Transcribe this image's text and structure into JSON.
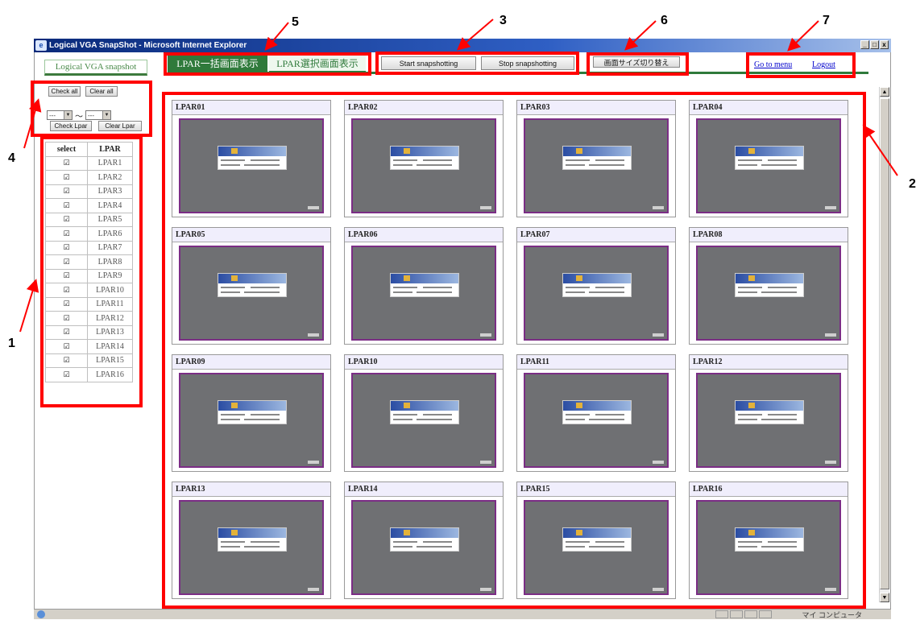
{
  "window": {
    "title": "Logical VGA SnapShot - Microsoft Internet Explorer",
    "controls": [
      "_",
      "□",
      "x"
    ],
    "status_zone": "マイ コンピュータ"
  },
  "app_title": "Logical VGA snapshot",
  "controls": {
    "check_all": "Check all",
    "clear_all": "Clear all",
    "range_from": "---",
    "range_sep": "～",
    "range_to": "---",
    "check_lpar": "Check Lpar",
    "clear_lpar": "Clear Lpar"
  },
  "table": {
    "headers": [
      "select",
      "LPAR"
    ],
    "rows": [
      {
        "checked": true,
        "name": "LPAR1"
      },
      {
        "checked": true,
        "name": "LPAR2"
      },
      {
        "checked": true,
        "name": "LPAR3"
      },
      {
        "checked": true,
        "name": "LPAR4"
      },
      {
        "checked": true,
        "name": "LPAR5"
      },
      {
        "checked": true,
        "name": "LPAR6"
      },
      {
        "checked": true,
        "name": "LPAR7"
      },
      {
        "checked": true,
        "name": "LPAR8"
      },
      {
        "checked": true,
        "name": "LPAR9"
      },
      {
        "checked": true,
        "name": "LPAR10"
      },
      {
        "checked": true,
        "name": "LPAR11"
      },
      {
        "checked": true,
        "name": "LPAR12"
      },
      {
        "checked": true,
        "name": "LPAR13"
      },
      {
        "checked": true,
        "name": "LPAR14"
      },
      {
        "checked": true,
        "name": "LPAR15"
      },
      {
        "checked": true,
        "name": "LPAR16"
      }
    ]
  },
  "tabs": {
    "all": "LPAR一括画面表示",
    "selected": "LPAR選択画面表示"
  },
  "toolbar": {
    "start": "Start snapshotting",
    "stop": "Stop snapshotting",
    "resize": "画面サイズ切り替え"
  },
  "nav": {
    "menu": "Go to menu",
    "logout": "Logout"
  },
  "snapshots": [
    "LPAR01",
    "LPAR02",
    "LPAR03",
    "LPAR04",
    "LPAR05",
    "LPAR06",
    "LPAR07",
    "LPAR08",
    "LPAR09",
    "LPAR10",
    "LPAR11",
    "LPAR12",
    "LPAR13",
    "LPAR14",
    "LPAR15",
    "LPAR16"
  ],
  "callouts": [
    "1",
    "2",
    "3",
    "4",
    "5",
    "6",
    "7"
  ],
  "colors": {
    "annotation": "#ff0000",
    "accent_green": "#2f7a3b",
    "screen_border": "#7b2d85"
  }
}
